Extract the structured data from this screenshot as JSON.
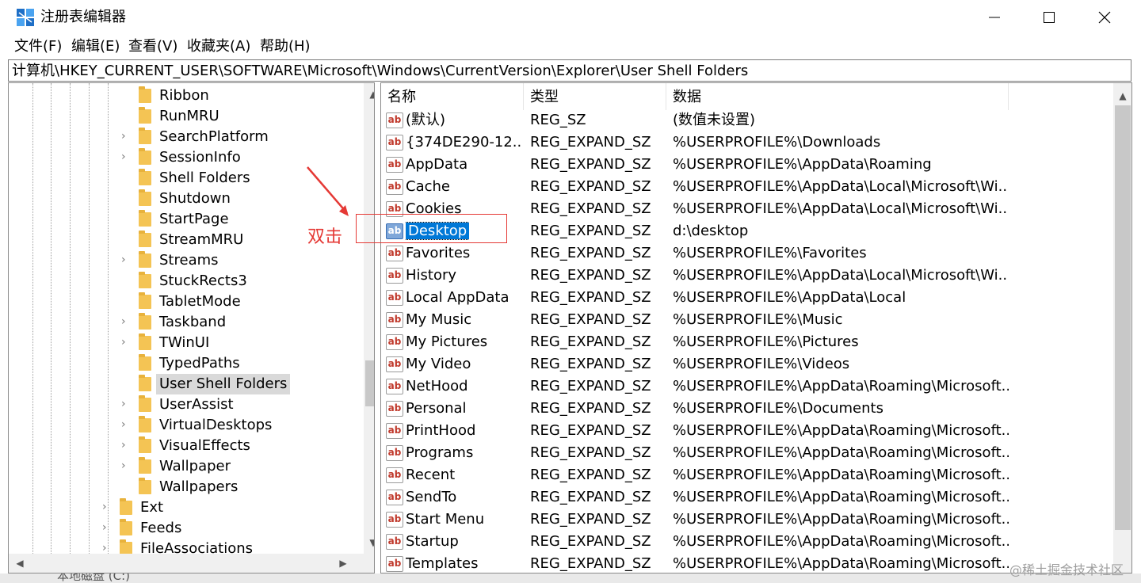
{
  "window": {
    "title": "注册表编辑器",
    "icon": "regedit-icon",
    "controls": {
      "minimize": "minimize-icon",
      "maximize": "maximize-icon",
      "close": "close-icon"
    }
  },
  "menu": {
    "items": [
      "文件(F)",
      "编辑(E)",
      "查看(V)",
      "收藏夹(A)",
      "帮助(H)"
    ]
  },
  "address": {
    "path": "计算机\\HKEY_CURRENT_USER\\SOFTWARE\\Microsoft\\Windows\\CurrentVersion\\Explorer\\User Shell Folders"
  },
  "tree": {
    "items": [
      {
        "label": "Ribbon",
        "expandable": false,
        "level": 2
      },
      {
        "label": "RunMRU",
        "expandable": false,
        "level": 2
      },
      {
        "label": "SearchPlatform",
        "expandable": true,
        "level": 2
      },
      {
        "label": "SessionInfo",
        "expandable": true,
        "level": 2
      },
      {
        "label": "Shell Folders",
        "expandable": false,
        "level": 2
      },
      {
        "label": "Shutdown",
        "expandable": false,
        "level": 2
      },
      {
        "label": "StartPage",
        "expandable": false,
        "level": 2
      },
      {
        "label": "StreamMRU",
        "expandable": false,
        "level": 2
      },
      {
        "label": "Streams",
        "expandable": true,
        "level": 2
      },
      {
        "label": "StuckRects3",
        "expandable": false,
        "level": 2
      },
      {
        "label": "TabletMode",
        "expandable": false,
        "level": 2
      },
      {
        "label": "Taskband",
        "expandable": true,
        "level": 2
      },
      {
        "label": "TWinUI",
        "expandable": true,
        "level": 2
      },
      {
        "label": "TypedPaths",
        "expandable": false,
        "level": 2
      },
      {
        "label": "User Shell Folders",
        "expandable": false,
        "level": 2,
        "selected": true
      },
      {
        "label": "UserAssist",
        "expandable": true,
        "level": 2
      },
      {
        "label": "VirtualDesktops",
        "expandable": true,
        "level": 2
      },
      {
        "label": "VisualEffects",
        "expandable": true,
        "level": 2
      },
      {
        "label": "Wallpaper",
        "expandable": true,
        "level": 2
      },
      {
        "label": "Wallpapers",
        "expandable": false,
        "level": 2
      },
      {
        "label": "Ext",
        "expandable": true,
        "level": 1
      },
      {
        "label": "Feeds",
        "expandable": true,
        "level": 1
      },
      {
        "label": "FileAssociations",
        "expandable": true,
        "level": 1
      }
    ]
  },
  "list": {
    "headers": {
      "name": "名称",
      "type": "类型",
      "data": "数据"
    },
    "rows": [
      {
        "name": "(默认)",
        "type": "REG_SZ",
        "data": "(数值未设置)"
      },
      {
        "name": "{374DE290-12...",
        "type": "REG_EXPAND_SZ",
        "data": "%USERPROFILE%\\Downloads"
      },
      {
        "name": "AppData",
        "type": "REG_EXPAND_SZ",
        "data": "%USERPROFILE%\\AppData\\Roaming"
      },
      {
        "name": "Cache",
        "type": "REG_EXPAND_SZ",
        "data": "%USERPROFILE%\\AppData\\Local\\Microsoft\\Wi..."
      },
      {
        "name": "Cookies",
        "type": "REG_EXPAND_SZ",
        "data": "%USERPROFILE%\\AppData\\Local\\Microsoft\\Wi..."
      },
      {
        "name": "Desktop",
        "type": "REG_EXPAND_SZ",
        "data": "d:\\desktop",
        "selected": true
      },
      {
        "name": "Favorites",
        "type": "REG_EXPAND_SZ",
        "data": "%USERPROFILE%\\Favorites"
      },
      {
        "name": "History",
        "type": "REG_EXPAND_SZ",
        "data": "%USERPROFILE%\\AppData\\Local\\Microsoft\\Wi..."
      },
      {
        "name": "Local AppData",
        "type": "REG_EXPAND_SZ",
        "data": "%USERPROFILE%\\AppData\\Local"
      },
      {
        "name": "My Music",
        "type": "REG_EXPAND_SZ",
        "data": "%USERPROFILE%\\Music"
      },
      {
        "name": "My Pictures",
        "type": "REG_EXPAND_SZ",
        "data": "%USERPROFILE%\\Pictures"
      },
      {
        "name": "My Video",
        "type": "REG_EXPAND_SZ",
        "data": "%USERPROFILE%\\Videos"
      },
      {
        "name": "NetHood",
        "type": "REG_EXPAND_SZ",
        "data": "%USERPROFILE%\\AppData\\Roaming\\Microsoft..."
      },
      {
        "name": "Personal",
        "type": "REG_EXPAND_SZ",
        "data": "%USERPROFILE%\\Documents"
      },
      {
        "name": "PrintHood",
        "type": "REG_EXPAND_SZ",
        "data": "%USERPROFILE%\\AppData\\Roaming\\Microsoft..."
      },
      {
        "name": "Programs",
        "type": "REG_EXPAND_SZ",
        "data": "%USERPROFILE%\\AppData\\Roaming\\Microsoft..."
      },
      {
        "name": "Recent",
        "type": "REG_EXPAND_SZ",
        "data": "%USERPROFILE%\\AppData\\Roaming\\Microsoft..."
      },
      {
        "name": "SendTo",
        "type": "REG_EXPAND_SZ",
        "data": "%USERPROFILE%\\AppData\\Roaming\\Microsoft..."
      },
      {
        "name": "Start Menu",
        "type": "REG_EXPAND_SZ",
        "data": "%USERPROFILE%\\AppData\\Roaming\\Microsoft..."
      },
      {
        "name": "Startup",
        "type": "REG_EXPAND_SZ",
        "data": "%USERPROFILE%\\AppData\\Roaming\\Microsoft..."
      },
      {
        "name": "Templates",
        "type": "REG_EXPAND_SZ",
        "data": "%USERPROFILE%\\AppData\\Roaming\\Microsoft..."
      }
    ],
    "value_icon_text": "ab"
  },
  "annotation": {
    "text": "双击",
    "color": "#e53935"
  },
  "taskbar": {
    "drive_text": "本地磁盘 (C:)"
  },
  "watermark": "@稀土掘金技术社区",
  "colors": {
    "selection": "#0078d7",
    "tree_selection": "#d9d9d9",
    "folder": "#f4c454",
    "annotation": "#e53935"
  }
}
